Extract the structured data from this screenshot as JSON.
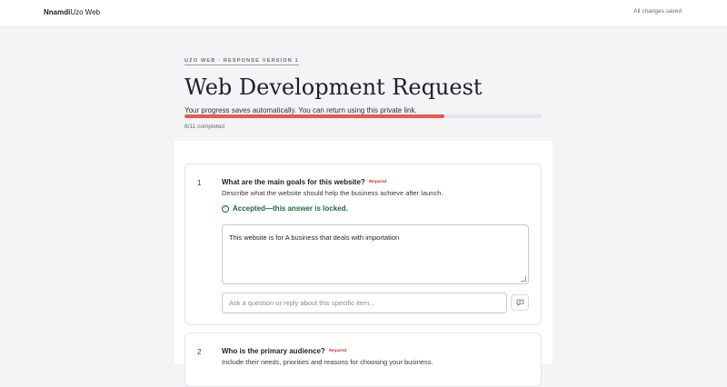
{
  "topbar": {
    "brand_bold": "Nnamdi",
    "brand_rest": "Uzo Web",
    "save_status": "All changes saved"
  },
  "header": {
    "eyebrow": "UZO WEB · RESPONSE VERSION 1",
    "title": "Web Development Request",
    "subtitle": "Your progress saves automatically. You can return using this private link."
  },
  "progress": {
    "label": "8/11 completed",
    "fraction": 0.727,
    "color": "#e8594f"
  },
  "questions": [
    {
      "number": "1",
      "title": "What are the main goals for this website?",
      "required_label": "Required",
      "description": "Describe what the website should help the business achieve after launch.",
      "status": "Accepted—this answer is locked.",
      "answer": "This website is for A business that deals with importation",
      "comment_placeholder": "Ask a question or reply about this specific item..."
    },
    {
      "number": "2",
      "title": "Who is the primary audience?",
      "required_label": "Required",
      "description": "Include their needs, priorities and reasons for choosing your business."
    }
  ],
  "colors": {
    "accepted": "#1e6b3a",
    "required": "#c0392b"
  },
  "icons": {
    "status": "check-circle-icon",
    "send": "chat-bubble-icon"
  }
}
